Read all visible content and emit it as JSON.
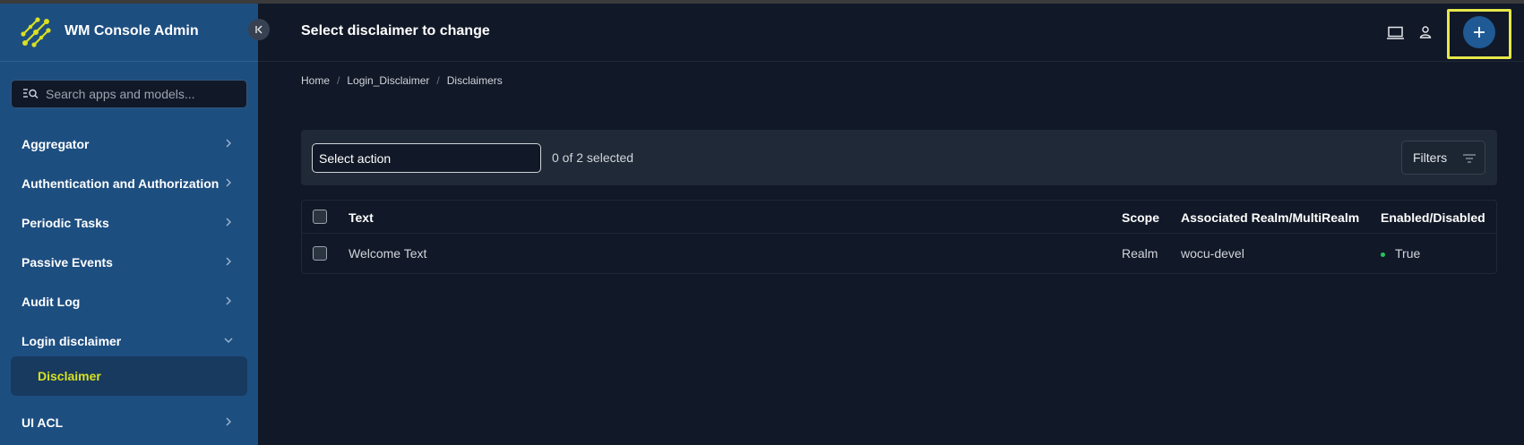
{
  "brand": {
    "title": "WM Console Admin"
  },
  "search": {
    "placeholder": "Search apps and models..."
  },
  "sidebar": {
    "items": [
      {
        "label": "Aggregator"
      },
      {
        "label": "Authentication and Authorization"
      },
      {
        "label": "Periodic Tasks"
      },
      {
        "label": "Passive Events"
      },
      {
        "label": "Audit Log"
      },
      {
        "label": "Login disclaimer",
        "expanded": true
      },
      {
        "label": "UI ACL"
      }
    ],
    "active_subitem": "Disclaimer"
  },
  "header": {
    "title": "Select disclaimer to change"
  },
  "breadcrumb": [
    "Home",
    "Login_Disclaimer",
    "Disclaimers"
  ],
  "actions": {
    "select_label": "Select action",
    "selected_count": "0 of 2 selected",
    "filters_label": "Filters"
  },
  "table": {
    "columns": [
      "Text",
      "Scope",
      "Associated Realm/MultiRealm",
      "Enabled/Disabled"
    ],
    "rows": [
      {
        "text": "Welcome Text",
        "scope": "Realm",
        "realm": "wocu-devel",
        "enabled": "True"
      }
    ]
  },
  "colors": {
    "sidebar_bg": "#1d4e80",
    "page_bg": "#111827",
    "accent_yellow": "#d9e021",
    "highlight": "#e5e84a",
    "status_green": "#22c55e"
  }
}
